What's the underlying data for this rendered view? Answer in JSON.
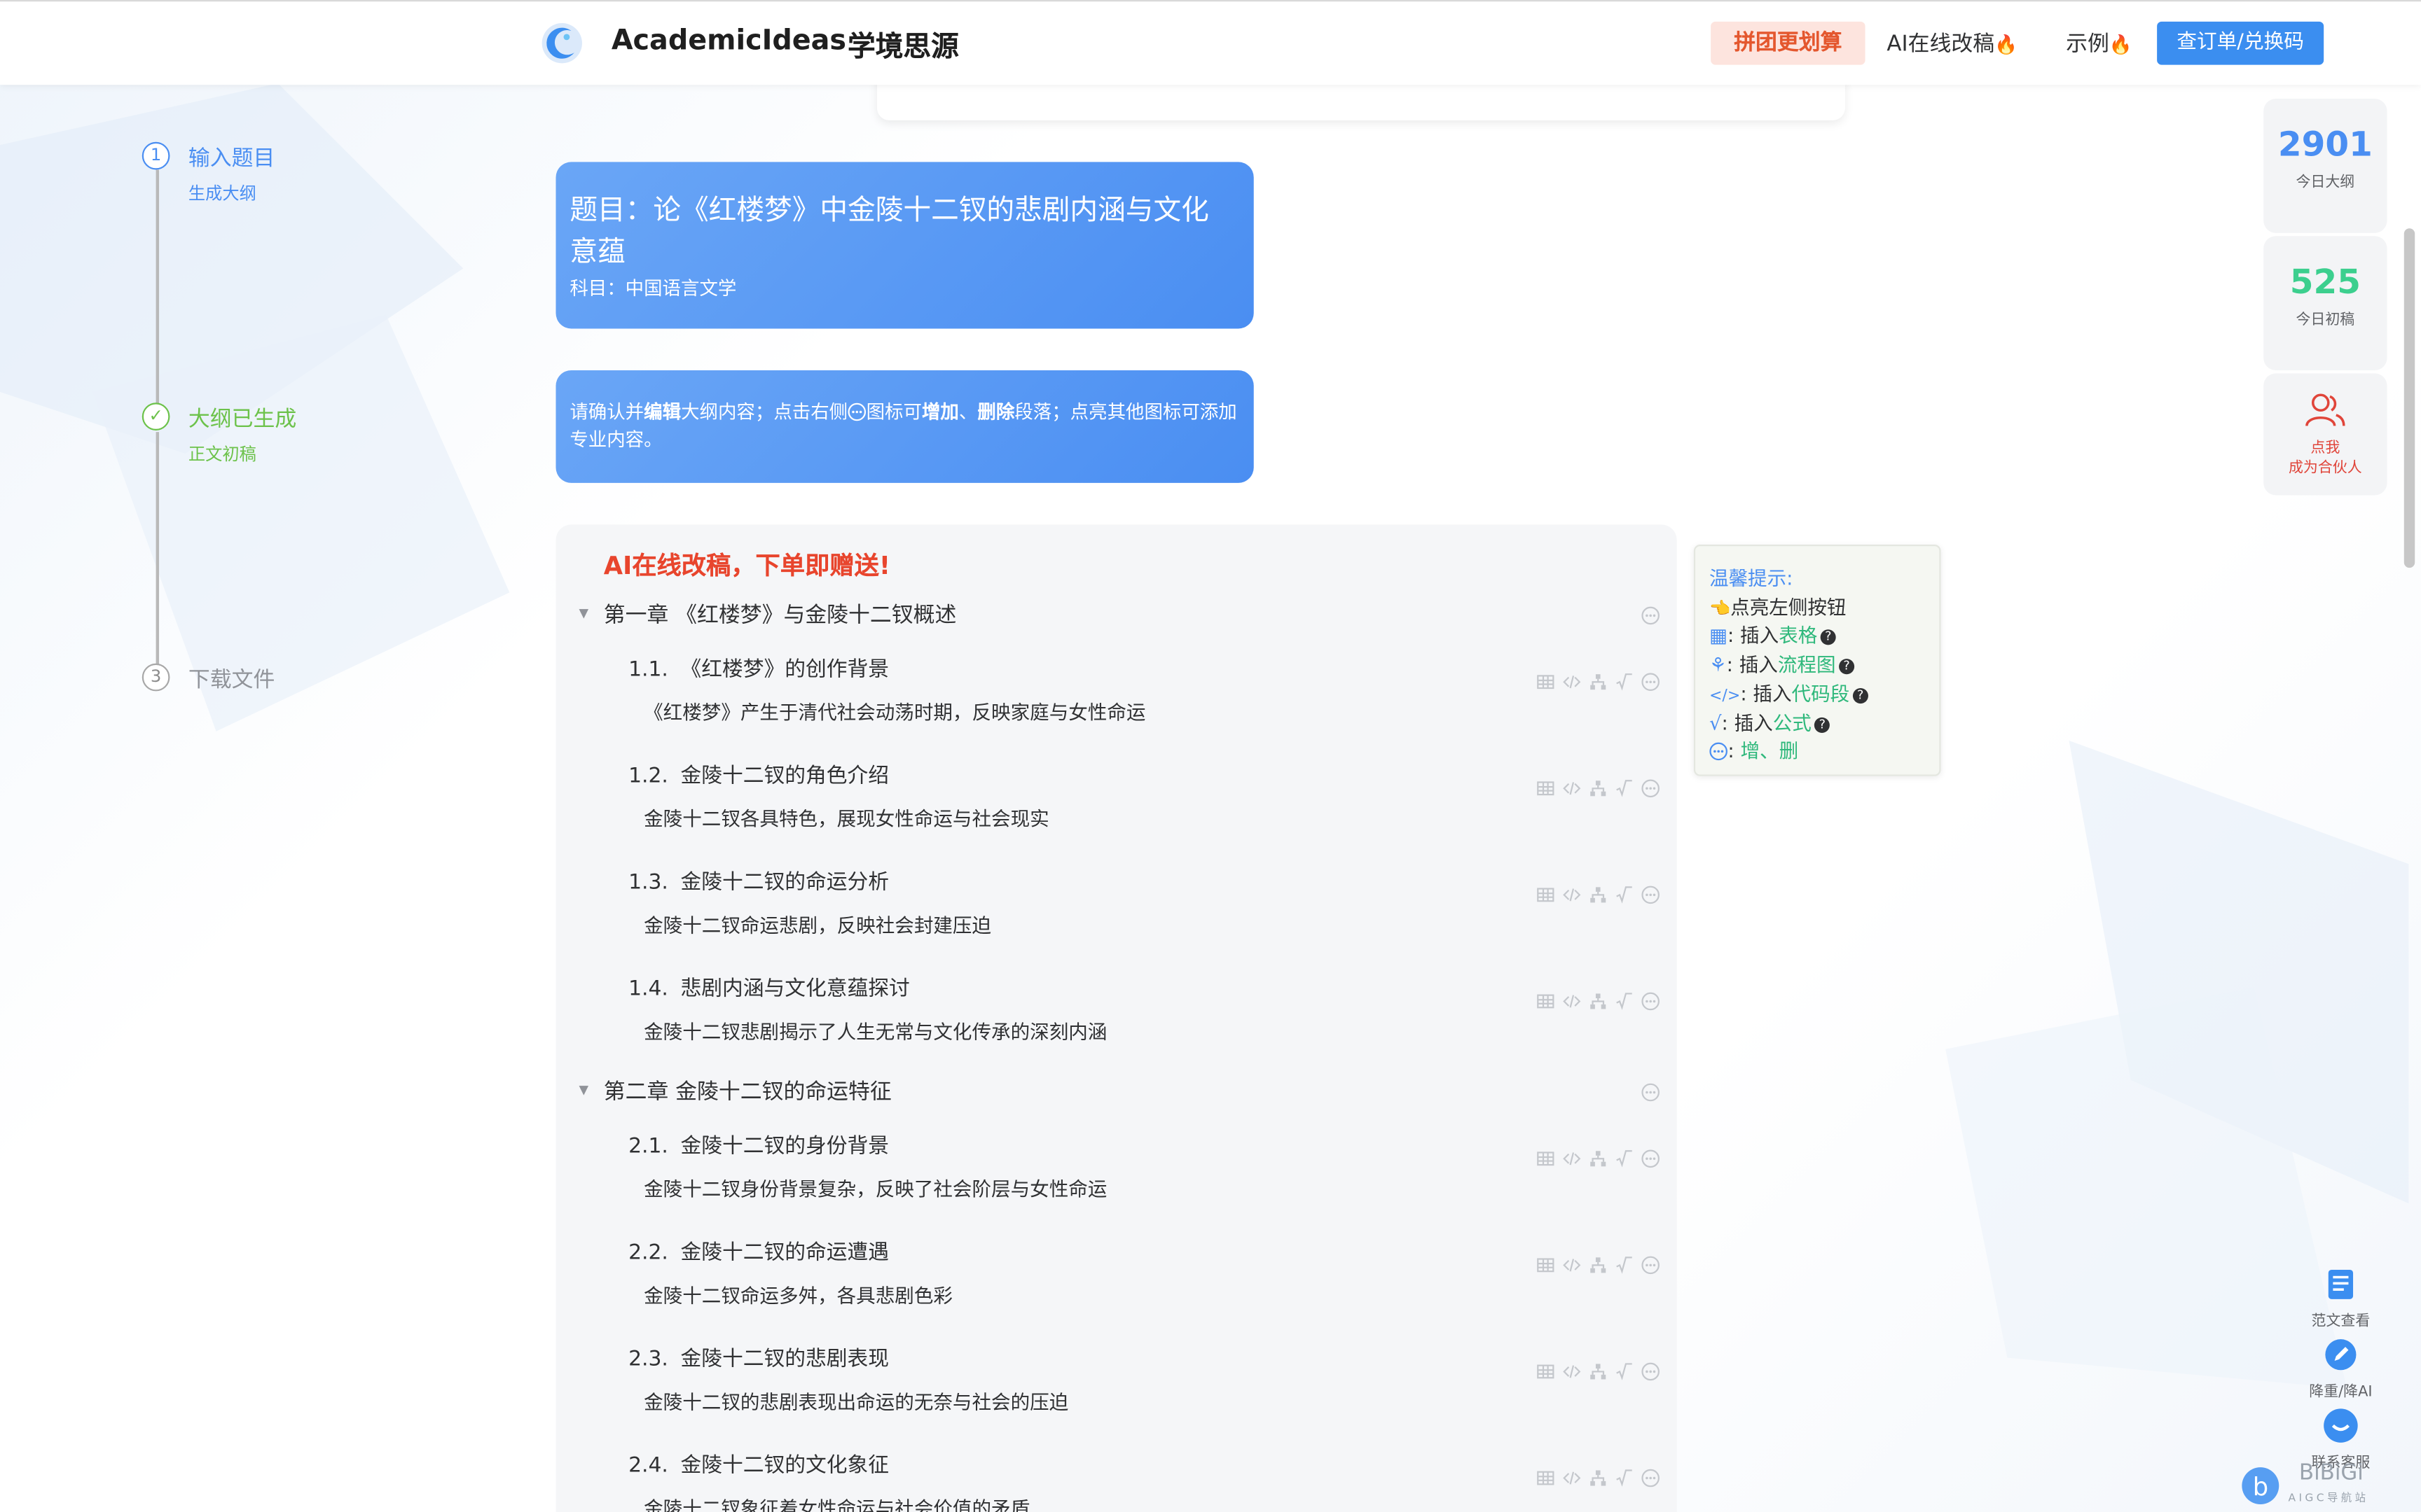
{
  "header": {
    "brand": "AcademicIdeas",
    "brand_cn": "学境思源",
    "group_buy": "拼团更划算",
    "ai_revise": "AI在线改稿",
    "examples": "示例",
    "check_order": "查订单/兑换码"
  },
  "steps": [
    {
      "num": "1",
      "title": "输入题目",
      "sub": "生成大纲"
    },
    {
      "num": "✓",
      "title": "大纲已生成",
      "sub": "正文初稿"
    },
    {
      "num": "3",
      "title": "下载文件",
      "sub": ""
    }
  ],
  "topic": {
    "title": "题目：论《红楼梦》中金陵十二钗的悲剧内涵与文化意蕴",
    "subject": "科目：中国语言文学"
  },
  "hint": {
    "p1": "请确认并",
    "b1": "编辑",
    "p2": "大纲内容；点击右侧",
    "p3": "图标可",
    "b2": "增加",
    "p4": "、",
    "b3": "删除",
    "p5": "段落；点亮其他图标可添加专业内容。"
  },
  "outline": {
    "promo": "AI在线改稿，下单即赠送!",
    "chapters": [
      {
        "title": "第一章 《红楼梦》与金陵十二钗概述",
        "sections": [
          {
            "num": "1.1.",
            "title": "《红楼梦》的创作背景",
            "desc": "《红楼梦》产生于清代社会动荡时期，反映家庭与女性命运"
          },
          {
            "num": "1.2.",
            "title": "金陵十二钗的角色介绍",
            "desc": "金陵十二钗各具特色，展现女性命运与社会现实"
          },
          {
            "num": "1.3.",
            "title": "金陵十二钗的命运分析",
            "desc": "金陵十二钗命运悲剧，反映社会封建压迫"
          },
          {
            "num": "1.4.",
            "title": "悲剧内涵与文化意蕴探讨",
            "desc": "金陵十二钗悲剧揭示了人生无常与文化传承的深刻内涵"
          }
        ]
      },
      {
        "title": "第二章 金陵十二钗的命运特征",
        "sections": [
          {
            "num": "2.1.",
            "title": "金陵十二钗的身份背景",
            "desc": "金陵十二钗身份背景复杂，反映了社会阶层与女性命运"
          },
          {
            "num": "2.2.",
            "title": "金陵十二钗的命运遭遇",
            "desc": "金陵十二钗命运多舛，各具悲剧色彩"
          },
          {
            "num": "2.3.",
            "title": "金陵十二钗的悲剧表现",
            "desc": "金陵十二钗的悲剧表现出命运的无奈与社会的压迫"
          },
          {
            "num": "2.4.",
            "title": "金陵十二钗的文化象征",
            "desc": "金陵十二钗象征着女性命运与社会价值的矛盾"
          }
        ]
      }
    ]
  },
  "tips": {
    "title": "温馨提示:",
    "line0": "点亮左侧按钮",
    "insert": "插入",
    "table": "表格",
    "flowchart": "流程图",
    "code": "代码段",
    "formula": "公式",
    "add_del": "增、删",
    "colon": ":"
  },
  "stats": {
    "outlines_num": "2901",
    "outlines_label": "今日大纲",
    "drafts_num": "525",
    "drafts_label": "今日初稿",
    "partner_line1": "点我",
    "partner_line2": "成为合伙人"
  },
  "side_tools": {
    "samples": "范文查看",
    "reduce": "降重/降AI",
    "service": "联系客服"
  },
  "watermark": {
    "text": "BiBiGi",
    "sub": "AIGC导航站"
  },
  "colors": {
    "primary": "#4a8ef2",
    "accent": "#2eb87b",
    "promo": "#e8452d",
    "stat1": "#4a8ef2",
    "stat2": "#3ccf8e"
  }
}
